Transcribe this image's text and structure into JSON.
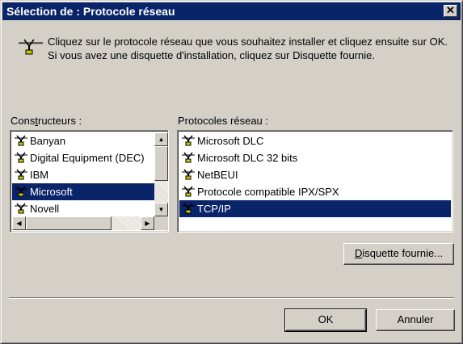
{
  "window": {
    "title": "Sélection de : Protocole réseau",
    "close_glyph": "✕"
  },
  "instruction": "Cliquez sur le protocole réseau que vous souhaitez installer et cliquez ensuite sur OK. Si vous avez une disquette d'installation, cliquez sur Disquette fournie.",
  "manufacturers": {
    "label_pre": "Cons",
    "label_accel": "t",
    "label_post": "ructeurs :",
    "items": [
      {
        "label": "Banyan",
        "selected": false
      },
      {
        "label": "Digital Equipment (DEC)",
        "selected": false
      },
      {
        "label": "IBM",
        "selected": false
      },
      {
        "label": "Microsoft",
        "selected": true
      },
      {
        "label": "Novell",
        "selected": false
      }
    ]
  },
  "protocols": {
    "label": "Protocoles réseau :",
    "items": [
      {
        "label": "Microsoft DLC",
        "selected": false
      },
      {
        "label": "Microsoft DLC 32 bits",
        "selected": false
      },
      {
        "label": "NetBEUI",
        "selected": false
      },
      {
        "label": "Protocole compatible IPX/SPX",
        "selected": false
      },
      {
        "label": "TCP/IP",
        "selected": true
      }
    ]
  },
  "buttons": {
    "disk_accel": "D",
    "disk_rest": "isquette fournie...",
    "ok": "OK",
    "cancel": "Annuler"
  },
  "icons": {
    "network": "network-protocol-icon"
  }
}
